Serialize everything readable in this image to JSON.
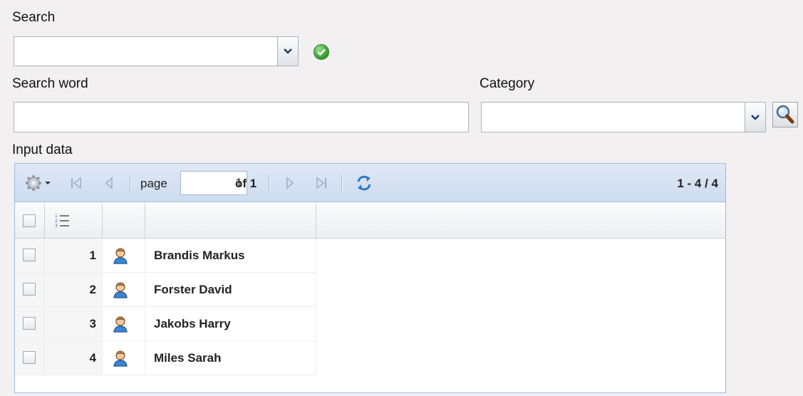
{
  "search": {
    "label": "Search",
    "value": ""
  },
  "search_word": {
    "label": "Search word",
    "value": ""
  },
  "category": {
    "label": "Category",
    "value": ""
  },
  "input_data": {
    "label": "Input data",
    "toolbar": {
      "page_label": "page",
      "page_value": "1",
      "of_label": "of 1",
      "range_text": "1 - 4 / 4"
    },
    "rows": [
      {
        "num": "1",
        "name": "Brandis Markus"
      },
      {
        "num": "2",
        "name": "Forster David"
      },
      {
        "num": "3",
        "name": "Jakobs Harry"
      },
      {
        "num": "4",
        "name": "Miles Sarah"
      }
    ]
  },
  "icons": {
    "ok": "check-circle-icon",
    "search": "magnifier-icon",
    "settings": "gear-icon",
    "refresh": "refresh-icon",
    "user": "person-icon",
    "row_numbering": "numbered-list-icon"
  },
  "colors": {
    "background": "#f2f0f0",
    "grid_border": "#99bbe8",
    "toolbar": "#dfe8f6",
    "ok_green": "#3aa336"
  }
}
